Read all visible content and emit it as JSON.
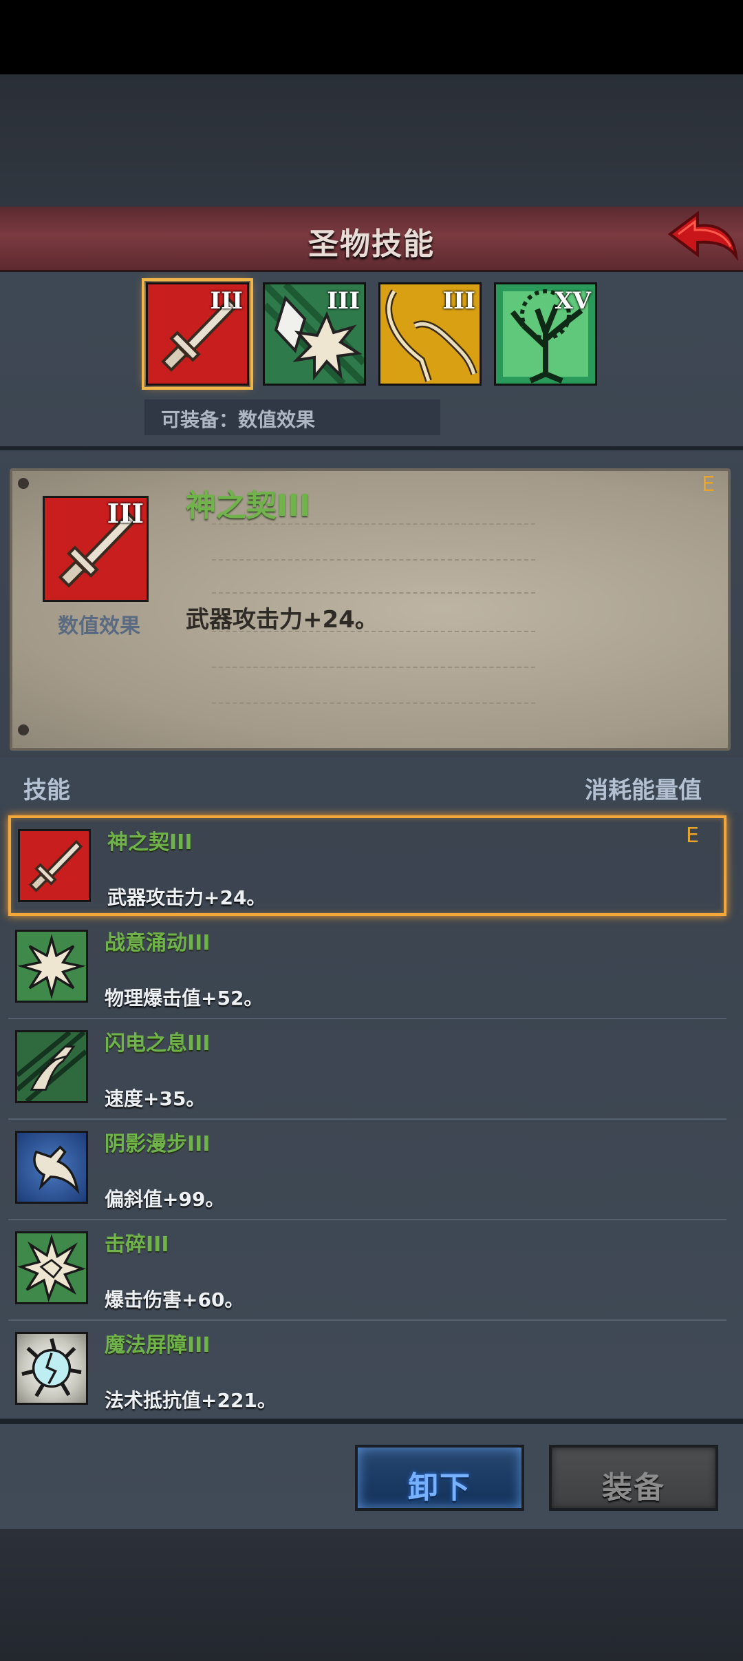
{
  "header": {
    "title": "圣物技能",
    "back_icon": "back-arrow-icon"
  },
  "relics": [
    {
      "icon": "sword-icon",
      "rank": "III",
      "color": "#c81e1e",
      "selected": true
    },
    {
      "icon": "crystal-burst-icon",
      "rank": "III",
      "color": "#2f7a4a",
      "selected": false
    },
    {
      "icon": "staff-icon",
      "rank": "III",
      "color": "#d8a012",
      "selected": false
    },
    {
      "icon": "tree-icon",
      "rank": "XV",
      "color": "#2a9a5a",
      "selected": false
    }
  ],
  "equip_hint": "可装备：数值效果",
  "detail": {
    "name": "神之契III",
    "description": "武器攻击力+24。",
    "type": "数值效果",
    "rank": "III",
    "equipped_mark": "E",
    "icon": "sword-icon"
  },
  "list_header": {
    "skill": "技能",
    "cost": "消耗能量值"
  },
  "skills": [
    {
      "name": "神之契III",
      "desc": "武器攻击力+24。",
      "icon": "sword-icon",
      "equipped": "E",
      "selected": true
    },
    {
      "name": "战意涌动III",
      "desc": "物理爆击值+52。",
      "icon": "starburst-icon",
      "equipped": "",
      "selected": false
    },
    {
      "name": "闪电之息III",
      "desc": "速度+35。",
      "icon": "lightning-bird-icon",
      "equipped": "",
      "selected": false
    },
    {
      "name": "阴影漫步III",
      "desc": "偏斜值+99。",
      "icon": "shadow-bird-icon",
      "equipped": "",
      "selected": false
    },
    {
      "name": "击碎III",
      "desc": "爆击伤害+60。",
      "icon": "shatter-icon",
      "equipped": "",
      "selected": false
    },
    {
      "name": "魔法屏障III",
      "desc": "法术抵抗值+221。",
      "icon": "magic-barrier-icon",
      "equipped": "",
      "selected": false
    }
  ],
  "buttons": {
    "unequip": "卸下",
    "equip": "装备"
  }
}
